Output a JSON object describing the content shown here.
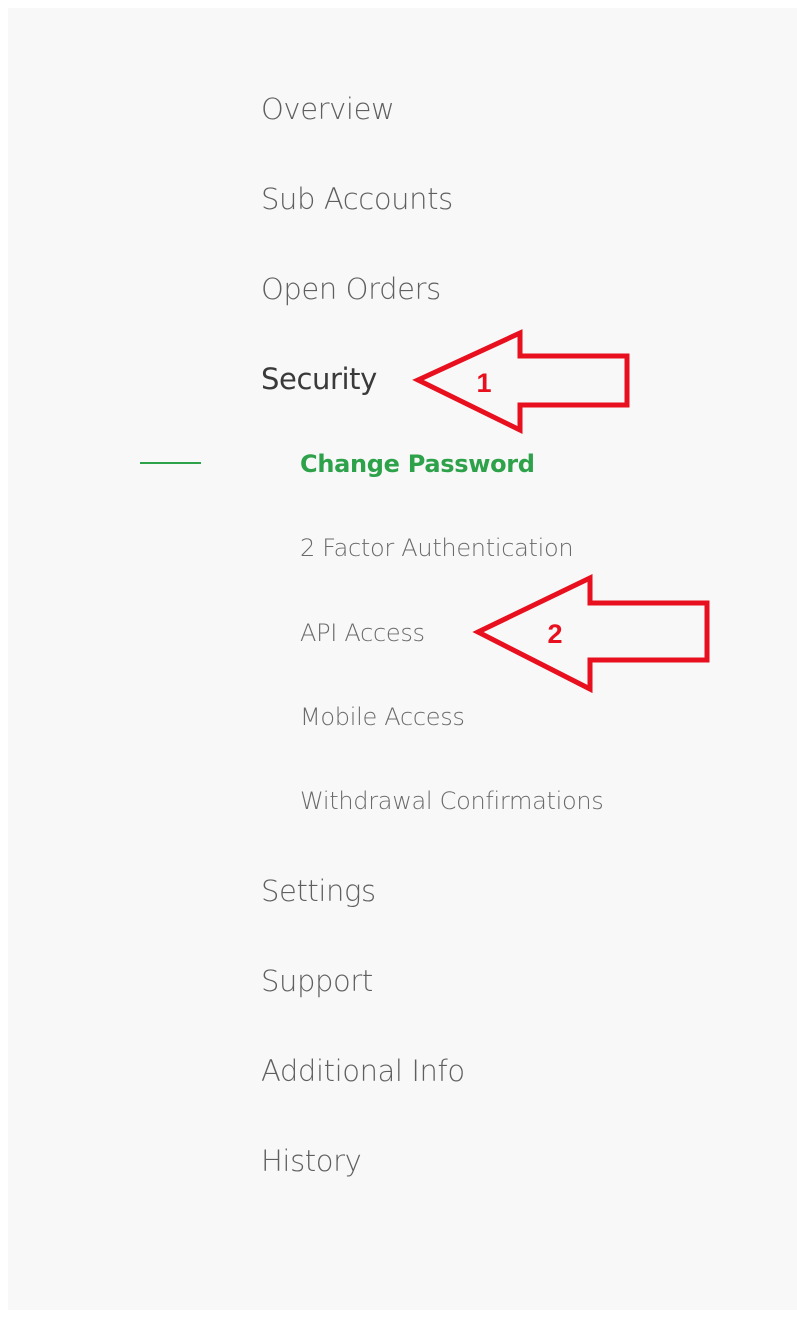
{
  "nav": {
    "items": [
      {
        "label": "Overview"
      },
      {
        "label": "Sub Accounts"
      },
      {
        "label": "Open Orders"
      },
      {
        "label": "Security"
      },
      {
        "label": "Settings"
      },
      {
        "label": "Support"
      },
      {
        "label": "Additional Info"
      },
      {
        "label": "History"
      }
    ],
    "security_subitems": [
      {
        "label": "Change Password"
      },
      {
        "label": "2 Factor Authentication"
      },
      {
        "label": "API Access"
      },
      {
        "label": "Mobile Access"
      },
      {
        "label": "Withdrawal Confirmations"
      }
    ]
  },
  "annotations": {
    "arrow1_label": "1",
    "arrow2_label": "2"
  },
  "colors": {
    "accent": "#2ea24a",
    "annotation": "#e8101e",
    "panel_bg": "#f8f8f8",
    "text": "#5f5f5f"
  }
}
